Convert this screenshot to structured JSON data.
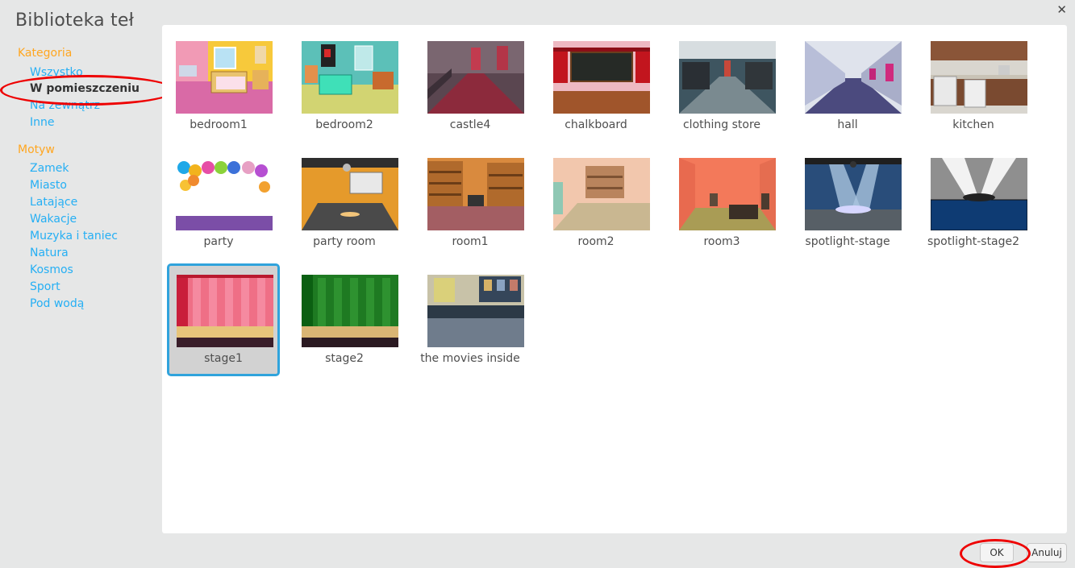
{
  "dialog": {
    "title": "Biblioteka teł",
    "close_glyph": "✕"
  },
  "sidebar": {
    "category_heading": "Kategoria",
    "categories": [
      "Wszystko",
      "W pomieszczeniu",
      "Na zewnątrz",
      "Inne"
    ],
    "selected_category": "W pomieszczeniu",
    "theme_heading": "Motyw",
    "themes": [
      "Zamek",
      "Miasto",
      "Latające",
      "Wakacje",
      "Muzyka i taniec",
      "Natura",
      "Kosmos",
      "Sport",
      "Pod wodą"
    ]
  },
  "library": {
    "items": [
      {
        "name": "bedroom1",
        "icon": "bedroom1-thumbnail"
      },
      {
        "name": "bedroom2",
        "icon": "bedroom2-thumbnail"
      },
      {
        "name": "castle4",
        "icon": "castle4-thumbnail"
      },
      {
        "name": "chalkboard",
        "icon": "chalkboard-thumbnail"
      },
      {
        "name": "clothing store",
        "icon": "clothing-store-thumbnail"
      },
      {
        "name": "hall",
        "icon": "hall-thumbnail"
      },
      {
        "name": "kitchen",
        "icon": "kitchen-thumbnail"
      },
      {
        "name": "party",
        "icon": "party-thumbnail"
      },
      {
        "name": "party room",
        "icon": "party-room-thumbnail"
      },
      {
        "name": "room1",
        "icon": "room1-thumbnail"
      },
      {
        "name": "room2",
        "icon": "room2-thumbnail"
      },
      {
        "name": "room3",
        "icon": "room3-thumbnail"
      },
      {
        "name": "spotlight-stage",
        "icon": "spotlight-stage-thumbnail"
      },
      {
        "name": "spotlight-stage2",
        "icon": "spotlight-stage2-thumbnail"
      },
      {
        "name": "stage1",
        "icon": "stage1-thumbnail"
      },
      {
        "name": "stage2",
        "icon": "stage2-thumbnail"
      },
      {
        "name": "the movies inside",
        "icon": "movies-inside-thumbnail"
      }
    ],
    "selected_item": "stage1"
  },
  "footer": {
    "ok_label": "OK",
    "cancel_label": "Anuluj"
  },
  "colors": {
    "accent": "#30a3dc",
    "heading": "#ffa620",
    "link": "#25aff4",
    "annotation": "#ee0000"
  }
}
